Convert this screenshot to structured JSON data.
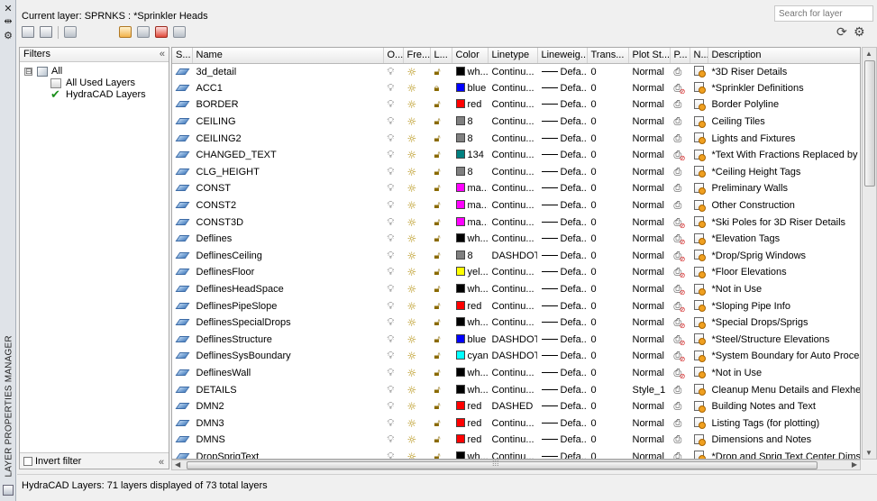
{
  "panel_title": "LAYER PROPERTIES MANAGER",
  "current_layer": "Current layer: SPRNKS : *Sprinkler Heads",
  "search": {
    "placeholder": "Search for layer"
  },
  "filters": {
    "header": "Filters",
    "tree": [
      {
        "label": "All",
        "expand": "⊟"
      },
      {
        "label": "All Used Layers"
      },
      {
        "label": "HydraCAD Layers"
      }
    ],
    "invert_label": "Invert filter"
  },
  "columns": [
    "S...",
    "Name",
    "O...",
    "Fre...",
    "L...",
    "Color",
    "Linetype",
    "Lineweig...",
    "Trans...",
    "Plot St...",
    "P...",
    "N...",
    "Description"
  ],
  "rows": [
    {
      "name": "3d_detail",
      "color_hex": "#000000",
      "color": "wh...",
      "linetype": "Continu...",
      "lw": "Defa...",
      "trans": "0",
      "plot_style": "Normal",
      "locked": false,
      "no_plot": false,
      "desc": "*3D Riser Details"
    },
    {
      "name": "ACC1",
      "color_hex": "#0000ff",
      "color": "blue",
      "linetype": "Continu...",
      "lw": "Defa...",
      "trans": "0",
      "plot_style": "Normal",
      "locked": true,
      "no_plot": true,
      "desc": "*Sprinkler Definitions"
    },
    {
      "name": "BORDER",
      "color_hex": "#ff0000",
      "color": "red",
      "linetype": "Continu...",
      "lw": "Defa...",
      "trans": "0",
      "plot_style": "Normal",
      "locked": false,
      "no_plot": false,
      "desc": "Border Polyline"
    },
    {
      "name": "CEILING",
      "color_hex": "#808080",
      "color": "8",
      "linetype": "Continu...",
      "lw": "Defa...",
      "trans": "0",
      "plot_style": "Normal",
      "locked": false,
      "no_plot": false,
      "desc": "Ceiling Tiles"
    },
    {
      "name": "CEILING2",
      "color_hex": "#808080",
      "color": "8",
      "linetype": "Continu...",
      "lw": "Defa...",
      "trans": "0",
      "plot_style": "Normal",
      "locked": false,
      "no_plot": false,
      "desc": "Lights and Fixtures"
    },
    {
      "name": "CHANGED_TEXT",
      "color_hex": "#008080",
      "color": "134",
      "linetype": "Continu...",
      "lw": "Defa...",
      "trans": "0",
      "plot_style": "Normal",
      "locked": false,
      "no_plot": true,
      "desc": "*Text With Fractions Replaced by St"
    },
    {
      "name": "CLG_HEIGHT",
      "color_hex": "#808080",
      "color": "8",
      "linetype": "Continu...",
      "lw": "Defa...",
      "trans": "0",
      "plot_style": "Normal",
      "locked": false,
      "no_plot": false,
      "desc": "*Ceiling Height Tags"
    },
    {
      "name": "CONST",
      "color_hex": "#ff00ff",
      "color": "ma...",
      "linetype": "Continu...",
      "lw": "Defa...",
      "trans": "0",
      "plot_style": "Normal",
      "locked": false,
      "no_plot": false,
      "desc": "Preliminary Walls"
    },
    {
      "name": "CONST2",
      "color_hex": "#ff00ff",
      "color": "ma...",
      "linetype": "Continu...",
      "lw": "Defa...",
      "trans": "0",
      "plot_style": "Normal",
      "locked": false,
      "no_plot": false,
      "desc": "Other Construction"
    },
    {
      "name": "CONST3D",
      "color_hex": "#ff00ff",
      "color": "ma...",
      "linetype": "Continu...",
      "lw": "Defa...",
      "trans": "0",
      "plot_style": "Normal",
      "locked": false,
      "no_plot": true,
      "desc": "*Ski Poles for 3D Riser Details"
    },
    {
      "name": "Deflines",
      "color_hex": "#000000",
      "color": "wh...",
      "linetype": "Continu...",
      "lw": "Defa...",
      "trans": "0",
      "plot_style": "Normal",
      "locked": false,
      "no_plot": true,
      "desc": "*Elevation Tags"
    },
    {
      "name": "DeflinesCeiling",
      "color_hex": "#808080",
      "color": "8",
      "linetype": "DASHDOT",
      "lw": "Defa...",
      "trans": "0",
      "plot_style": "Normal",
      "locked": false,
      "no_plot": true,
      "desc": "*Drop/Sprig Windows"
    },
    {
      "name": "DeflinesFloor",
      "color_hex": "#ffff00",
      "color": "yel...",
      "linetype": "Continu...",
      "lw": "Defa...",
      "trans": "0",
      "plot_style": "Normal",
      "locked": false,
      "no_plot": true,
      "desc": "*Floor Elevations"
    },
    {
      "name": "DeflinesHeadSpace",
      "color_hex": "#000000",
      "color": "wh...",
      "linetype": "Continu...",
      "lw": "Defa...",
      "trans": "0",
      "plot_style": "Normal",
      "locked": false,
      "no_plot": true,
      "desc": "*Not in Use"
    },
    {
      "name": "DeflinesPipeSlope",
      "color_hex": "#ff0000",
      "color": "red",
      "linetype": "Continu...",
      "lw": "Defa...",
      "trans": "0",
      "plot_style": "Normal",
      "locked": false,
      "no_plot": true,
      "desc": "*Sloping Pipe Info"
    },
    {
      "name": "DeflinesSpecialDrops",
      "color_hex": "#000000",
      "color": "wh...",
      "linetype": "Continu...",
      "lw": "Defa...",
      "trans": "0",
      "plot_style": "Normal",
      "locked": false,
      "no_plot": true,
      "desc": "*Special Drops/Sprigs"
    },
    {
      "name": "DeflinesStructure",
      "color_hex": "#0000ff",
      "color": "blue",
      "linetype": "DASHDOT",
      "lw": "Defa...",
      "trans": "0",
      "plot_style": "Normal",
      "locked": false,
      "no_plot": true,
      "desc": "*Steel/Structure Elevations"
    },
    {
      "name": "DeflinesSysBoundary",
      "color_hex": "#00ffff",
      "color": "cyan",
      "linetype": "DASHDOT",
      "lw": "Defa...",
      "trans": "0",
      "plot_style": "Normal",
      "locked": false,
      "no_plot": true,
      "desc": "*System Boundary for Auto Processe"
    },
    {
      "name": "DeflinesWall",
      "color_hex": "#000000",
      "color": "wh...",
      "linetype": "Continu...",
      "lw": "Defa...",
      "trans": "0",
      "plot_style": "Normal",
      "locked": false,
      "no_plot": true,
      "desc": "*Not in Use"
    },
    {
      "name": "DETAILS",
      "color_hex": "#000000",
      "color": "wh...",
      "linetype": "Continu...",
      "lw": "Defa...",
      "trans": "0",
      "plot_style": "Style_1",
      "locked": false,
      "no_plot": false,
      "desc": "Cleanup Menu Details and Flexheac"
    },
    {
      "name": "DMN2",
      "color_hex": "#ff0000",
      "color": "red",
      "linetype": "DASHED",
      "lw": "Defa...",
      "trans": "0",
      "plot_style": "Normal",
      "locked": false,
      "no_plot": false,
      "desc": "Building Notes and Text"
    },
    {
      "name": "DMN3",
      "color_hex": "#ff0000",
      "color": "red",
      "linetype": "Continu...",
      "lw": "Defa...",
      "trans": "0",
      "plot_style": "Normal",
      "locked": false,
      "no_plot": false,
      "desc": "Listing Tags (for plotting)"
    },
    {
      "name": "DMNS",
      "color_hex": "#ff0000",
      "color": "red",
      "linetype": "Continu...",
      "lw": "Defa...",
      "trans": "0",
      "plot_style": "Normal",
      "locked": false,
      "no_plot": false,
      "desc": "Dimensions and Notes"
    },
    {
      "name": "DropSprigText",
      "color_hex": "#000000",
      "color": "wh...",
      "linetype": "Continu...",
      "lw": "Defa...",
      "trans": "0",
      "plot_style": "Normal",
      "locked": false,
      "no_plot": false,
      "desc": "*Drop and Sprig Text Center Dims"
    }
  ],
  "status_text": "HydraCAD Layers: 71 layers displayed of 73 total layers",
  "icons": [
    "close-icon",
    "pin-icon",
    "settings-icon",
    "folder-icon",
    "new-layer-icon",
    "delete-layer-icon",
    "set-current-icon",
    "refresh-icon",
    "gear-icon",
    "sun-icon",
    "lightbulb-icon",
    "lock-icon",
    "printer-icon",
    "viewport-freeze-icon"
  ]
}
